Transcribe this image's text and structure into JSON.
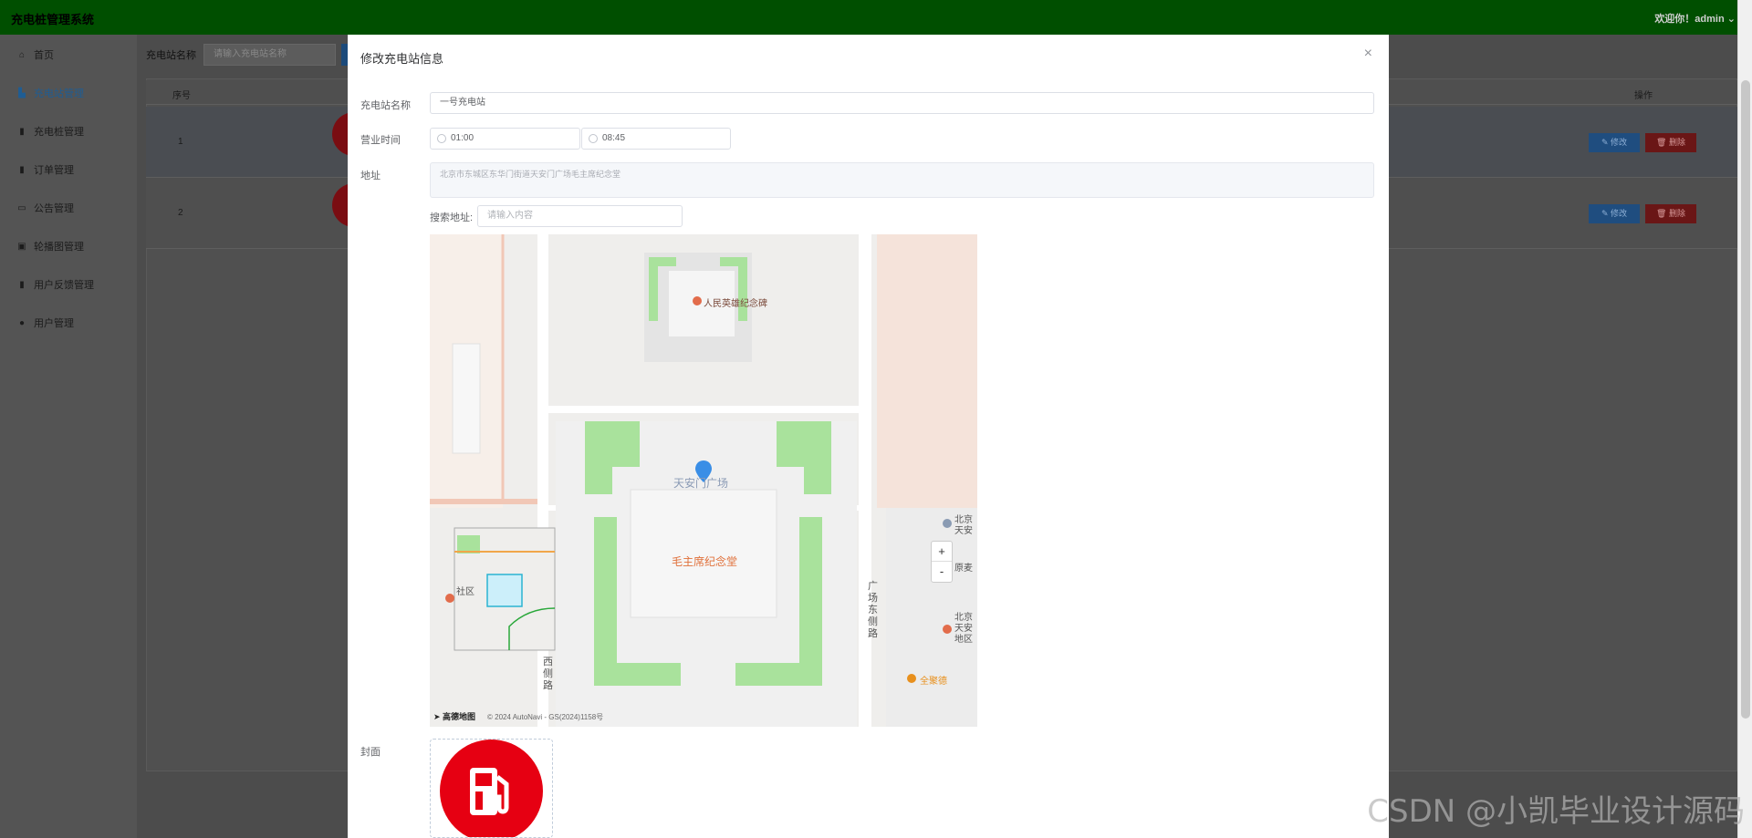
{
  "app": {
    "title": "充电桩管理系统",
    "welcome": "欢迎你！admin"
  },
  "sidebar": {
    "items": [
      {
        "label": "首页",
        "icon": "home-icon"
      },
      {
        "label": "充电站管理",
        "icon": "station-icon"
      },
      {
        "label": "充电桩管理",
        "icon": "bar-chart-icon"
      },
      {
        "label": "订单管理",
        "icon": "bar-chart-icon"
      },
      {
        "label": "公告管理",
        "icon": "monitor-icon"
      },
      {
        "label": "轮播图管理",
        "icon": "image-icon"
      },
      {
        "label": "用户反馈管理",
        "icon": "bar-chart-icon"
      },
      {
        "label": "用户管理",
        "icon": "user-icon"
      }
    ]
  },
  "search": {
    "label": "充电站名称",
    "placeholder": "请输入充电站名称"
  },
  "table": {
    "headers": {
      "index": "序号",
      "ops": "操作"
    },
    "rows": [
      {
        "index": "1"
      },
      {
        "index": "2"
      }
    ],
    "edit_label": "✎ 修改",
    "delete_label": "🗑 删除"
  },
  "modal": {
    "title": "修改充电站信息",
    "name_label": "充电站名称",
    "name_value": "一号充电站",
    "hours_label": "营业时间",
    "open_time": "01:00",
    "close_time": "08:45",
    "address_label": "地址",
    "address_value": "北京市东城区东华门街道天安门广场毛主席纪念堂",
    "search_address_label": "搜索地址:",
    "search_address_placeholder": "请输入内容",
    "cover_label": "封面"
  },
  "map": {
    "labels": {
      "monument": "人民英雄纪念碑",
      "square": "天安门广场",
      "hall": "毛主席纪念堂",
      "east_road": "广场东侧路",
      "west_road": "西侧路",
      "community": "社区",
      "poi1": "北京",
      "poi1b": "天安",
      "poi2": "原麦",
      "poi3": "北京",
      "poi3b": "天安",
      "poi3c": "地区",
      "poi4": "全聚德"
    },
    "zoom_in": "+",
    "zoom_out": "-",
    "logo": "高德地图",
    "copyright": "© 2024 AutoNavi - GS(2024)1158号"
  },
  "watermark": "CSDN @小凯毕业设计源码"
}
